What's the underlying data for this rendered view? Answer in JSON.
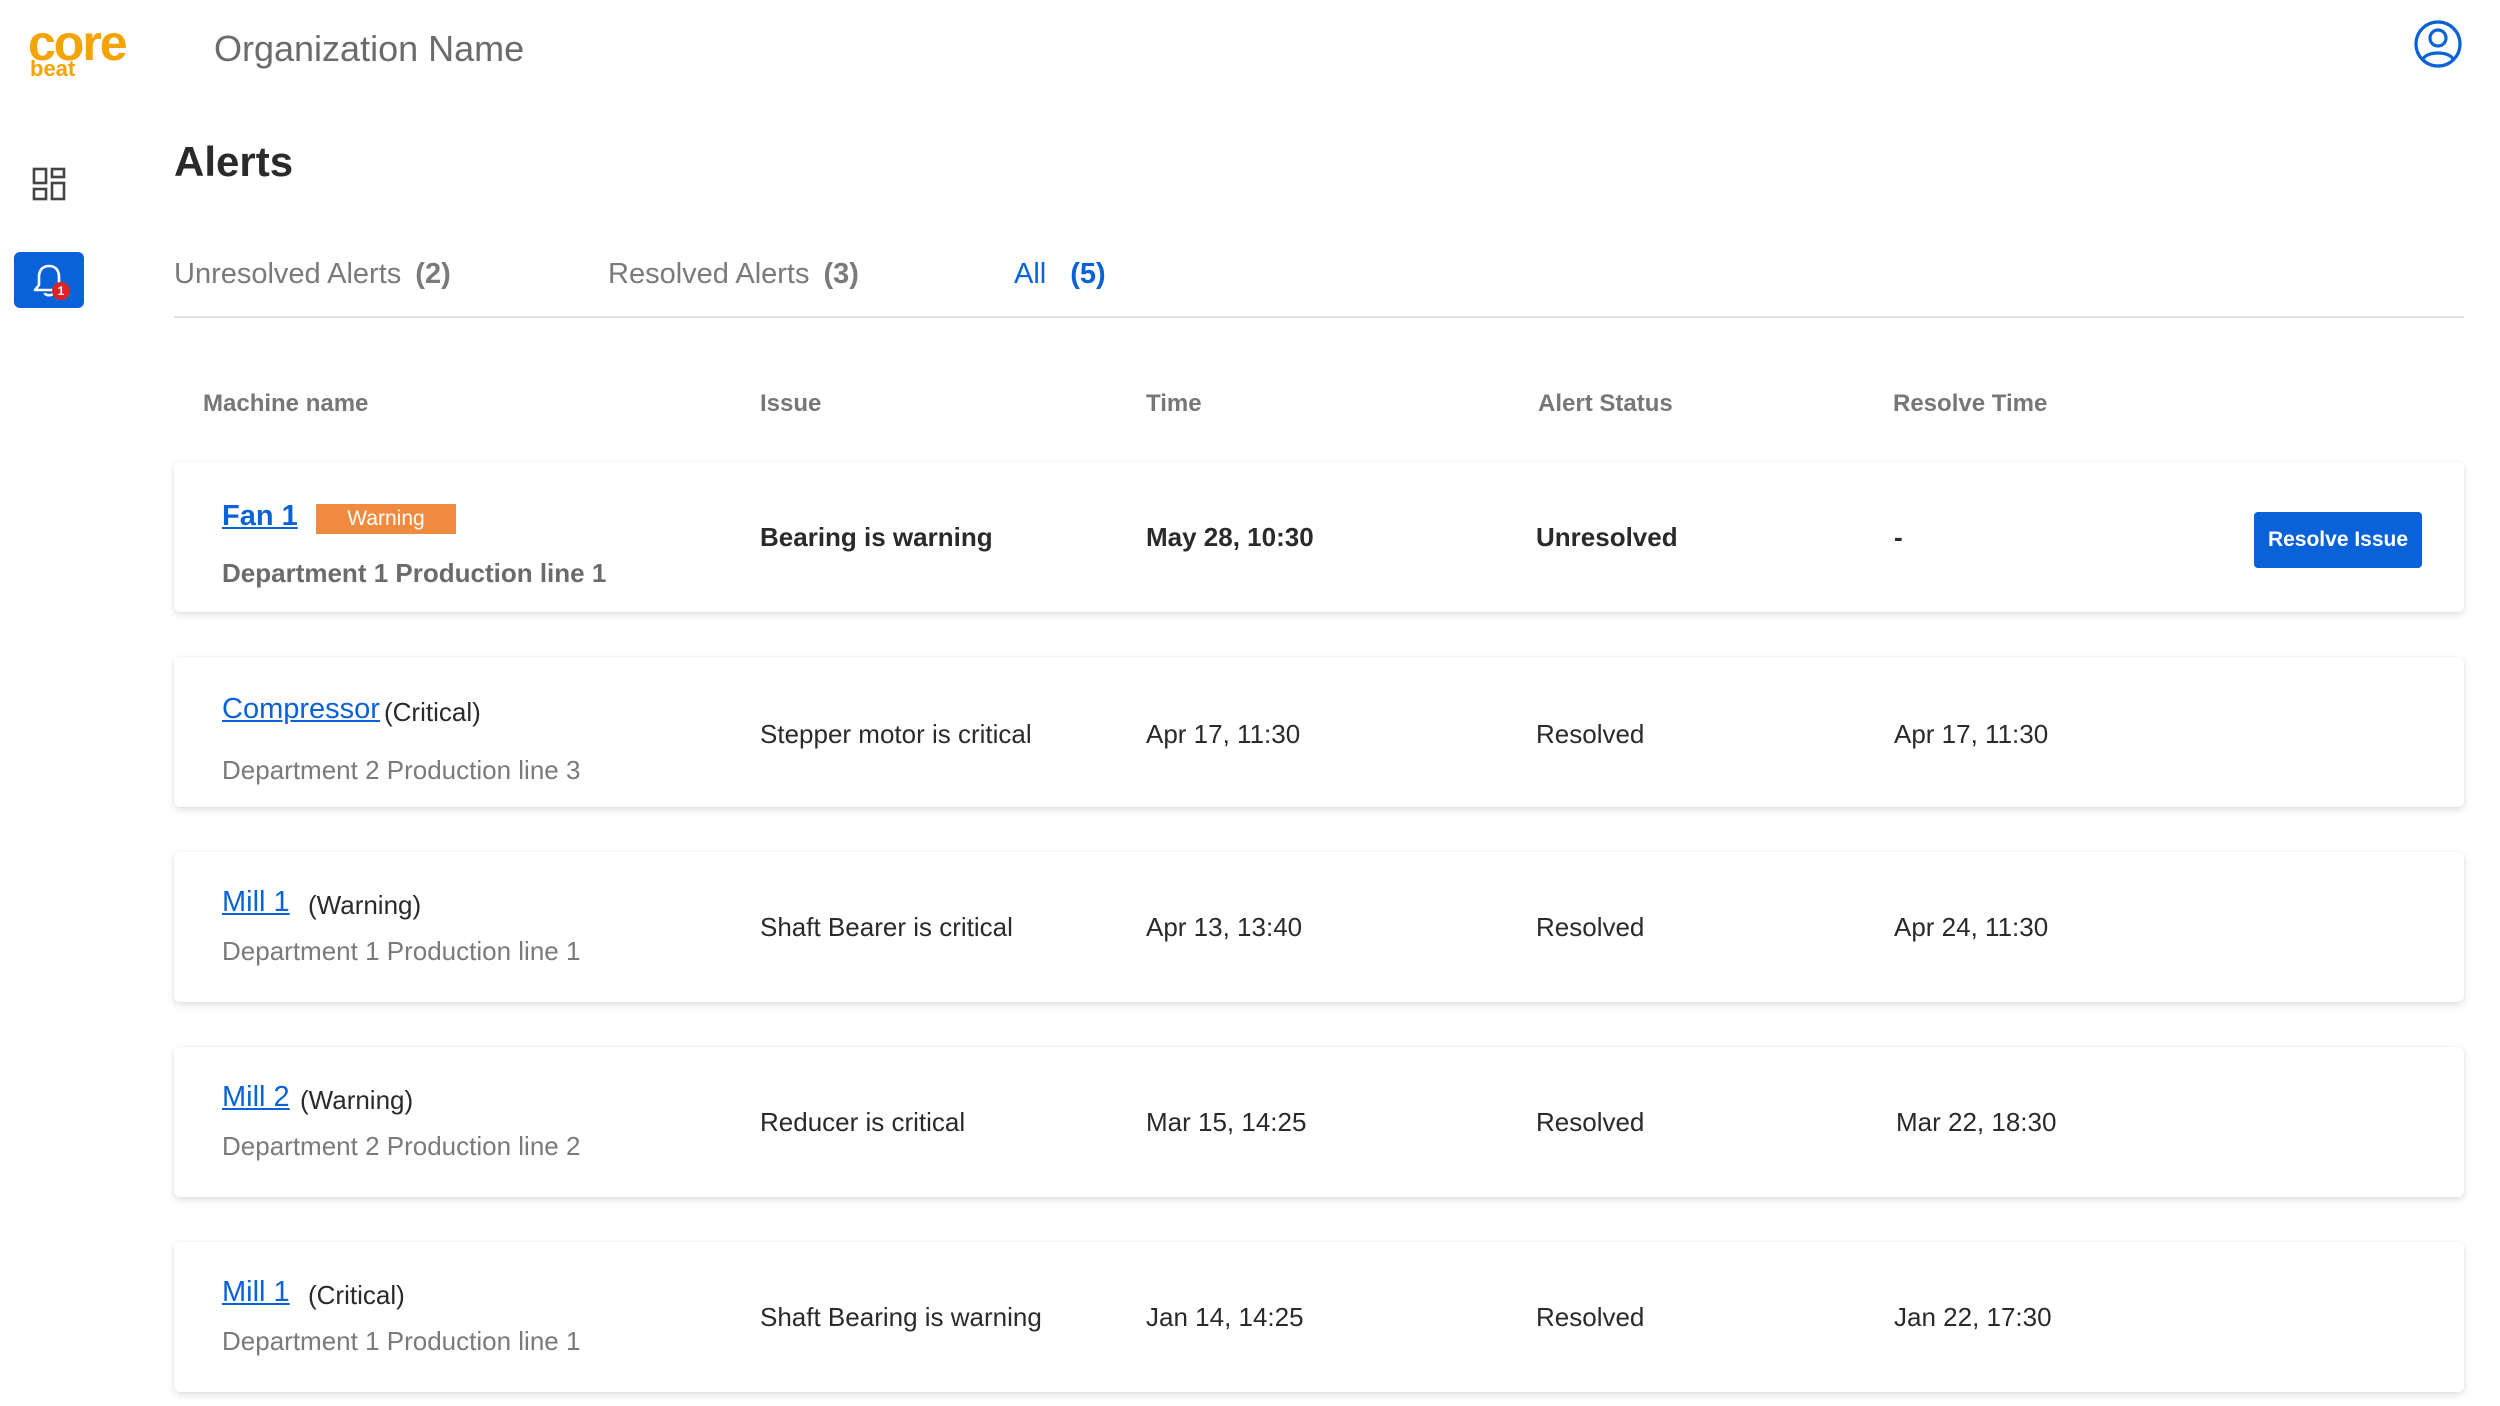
{
  "brand": {
    "logo_top": "core",
    "logo_bottom": "beat",
    "accent": "#f5a300",
    "primary": "#0a62d8"
  },
  "sidebar": {
    "items": [
      {
        "name": "dashboard",
        "icon": "grid-icon",
        "active": false
      },
      {
        "name": "alerts",
        "icon": "bell-icon",
        "active": true,
        "badge": "1"
      }
    ]
  },
  "header": {
    "org_name": "Organization Name",
    "user_icon": "user-circle-icon"
  },
  "page": {
    "title": "Alerts"
  },
  "tabs": [
    {
      "label": "Unresolved Alerts",
      "count": "(2)",
      "active": false
    },
    {
      "label": "Resolved Alerts",
      "count": "(3)",
      "active": false
    },
    {
      "label": "All",
      "count": "(5)",
      "active": true
    }
  ],
  "table": {
    "columns": [
      "Machine name",
      "Issue",
      "Time",
      "Alert Status",
      "Resolve Time"
    ],
    "rows": [
      {
        "machine": "Fan 1",
        "severity": "",
        "badge": "Warning",
        "location": "Department 1 Production line 1",
        "issue": "Bearing is warning",
        "time": "May 28, 10:30",
        "status": "Unresolved",
        "resolve_time": "-",
        "action": "Resolve Issue"
      },
      {
        "machine": "Compressor",
        "severity": "(Critical)",
        "location": "Department 2 Production line 3",
        "issue": "Stepper motor is critical",
        "time": "Apr 17, 11:30",
        "status": "Resolved",
        "resolve_time": "Apr 17, 11:30"
      },
      {
        "machine": "Mill 1",
        "severity": "(Warning)",
        "location": "Department 1 Production line 1",
        "issue": "Shaft Bearer is critical",
        "time": "Apr 13, 13:40",
        "status": "Resolved",
        "resolve_time": "Apr 24, 11:30"
      },
      {
        "machine": "Mill 2",
        "severity": "(Warning)",
        "location": "Department 2 Production line 2",
        "issue": "Reducer is critical",
        "time": "Mar 15, 14:25",
        "status": "Resolved",
        "resolve_time": "Mar 22, 18:30"
      },
      {
        "machine": "Mill 1",
        "severity": "(Critical)",
        "location": "Department 1 Production line 1",
        "issue": "Shaft Bearing is warning",
        "time": "Jan 14, 14:25",
        "status": "Resolved",
        "resolve_time": "Jan 22, 17:30"
      }
    ]
  }
}
